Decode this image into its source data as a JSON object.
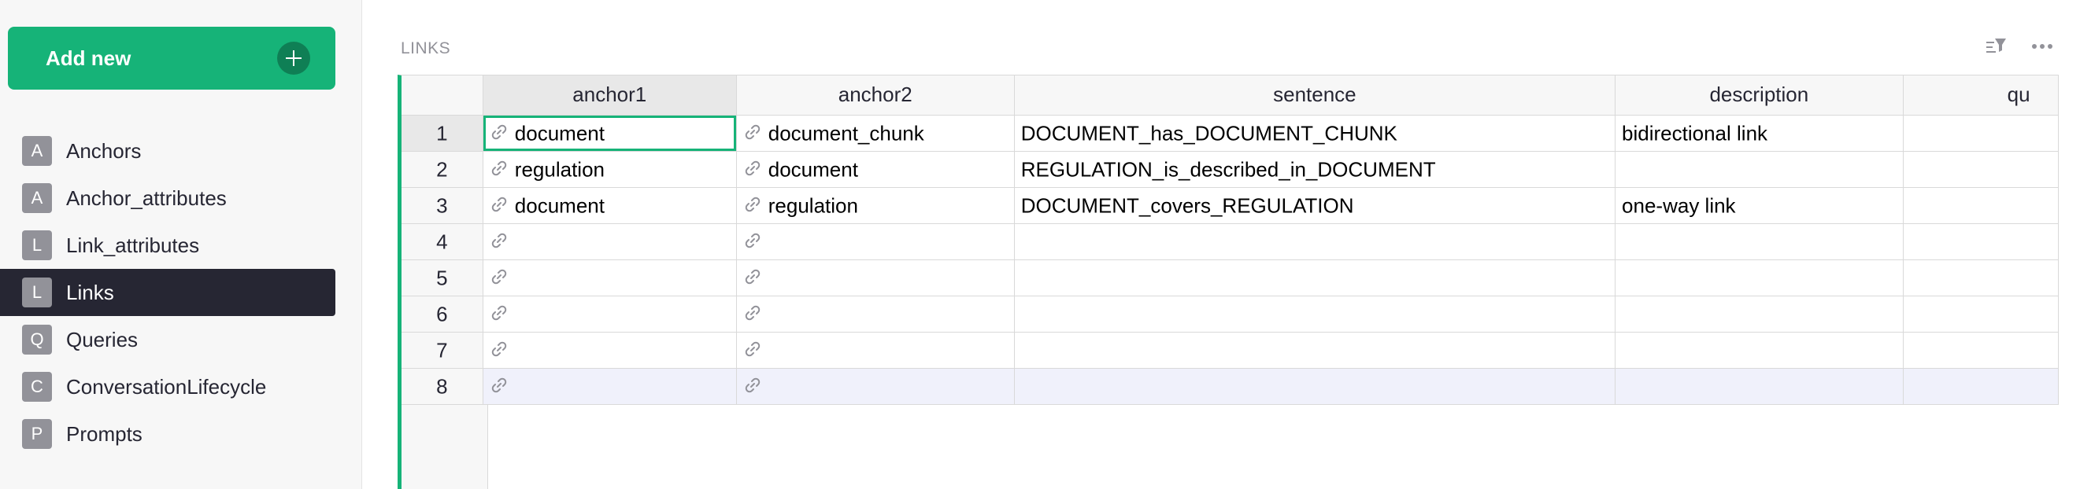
{
  "sidebar": {
    "add_new_label": "Add new",
    "pages": [
      {
        "initial": "A",
        "name": "Anchors",
        "active": false
      },
      {
        "initial": "A",
        "name": "Anchor_attributes",
        "active": false
      },
      {
        "initial": "L",
        "name": "Link_attributes",
        "active": false
      },
      {
        "initial": "L",
        "name": "Links",
        "active": true
      },
      {
        "initial": "Q",
        "name": "Queries",
        "active": false
      },
      {
        "initial": "C",
        "name": "ConversationLifecycle",
        "active": false
      },
      {
        "initial": "P",
        "name": "Prompts",
        "active": false
      }
    ]
  },
  "section": {
    "title": "LINKS"
  },
  "grid": {
    "columns": [
      "anchor1",
      "anchor2",
      "sentence",
      "description",
      "qu"
    ],
    "rows": [
      {
        "num": "1",
        "anchor1": "document",
        "anchor2": "document_chunk",
        "sentence": "DOCUMENT_has_DOCUMENT_CHUNK",
        "description": "bidirectional link",
        "q": ""
      },
      {
        "num": "2",
        "anchor1": "regulation",
        "anchor2": "document",
        "sentence": "REGULATION_is_described_in_DOCUMENT",
        "description": "",
        "q": ""
      },
      {
        "num": "3",
        "anchor1": "document",
        "anchor2": "regulation",
        "sentence": "DOCUMENT_covers_REGULATION",
        "description": "one-way link",
        "q": ""
      },
      {
        "num": "4",
        "anchor1": "",
        "anchor2": "",
        "sentence": "",
        "description": "",
        "q": ""
      },
      {
        "num": "5",
        "anchor1": "",
        "anchor2": "",
        "sentence": "",
        "description": "",
        "q": ""
      },
      {
        "num": "6",
        "anchor1": "",
        "anchor2": "",
        "sentence": "",
        "description": "",
        "q": ""
      },
      {
        "num": "7",
        "anchor1": "",
        "anchor2": "",
        "sentence": "",
        "description": "",
        "q": ""
      },
      {
        "num": "8",
        "anchor1": "",
        "anchor2": "",
        "sentence": "",
        "description": "",
        "q": ""
      }
    ]
  },
  "colors": {
    "accent": "#16b378",
    "active_nav": "#262633",
    "new_row": "#f0f1fb"
  },
  "icons": {
    "add": "plus-icon",
    "link": "link-icon",
    "sort_filter": "sort-filter-icon",
    "more": "more-icon"
  }
}
